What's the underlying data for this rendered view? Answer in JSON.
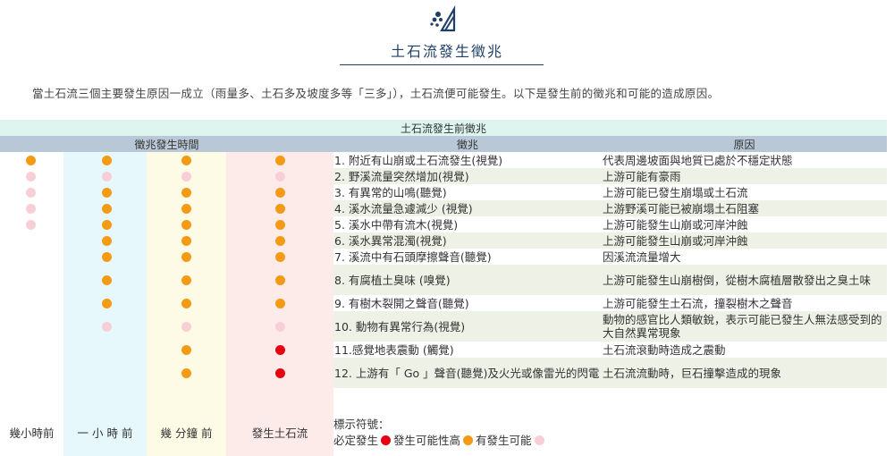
{
  "header": {
    "title": "土石流發生徵兆"
  },
  "intro": "當土石流三個主要發生原因一成立（雨量多、土石多及坡度多等「三多」），土石流便可能發生。以下是發生前的徵兆和可能的造成原因。",
  "table": {
    "caption": "土石流發生前徵兆",
    "col_time": "徵兆發生時間",
    "col_sign": "徵兆",
    "col_cause": "原因",
    "time_labels": [
      "幾小時前",
      "一 小 時 前",
      "幾 分鐘 前",
      "發生土石流"
    ],
    "rows": [
      {
        "sign": "1. 附近有山崩或土石流發生(視覺)",
        "cause": "代表周邊坡面與地質已處於不穩定狀態",
        "dots": [
          "orange",
          "orange",
          "orange",
          "orange"
        ]
      },
      {
        "sign": "2. 野溪流量突然增加(視覺)",
        "cause": "上游可能有豪雨",
        "dots": [
          "pink",
          "pink",
          "pink",
          "pink"
        ]
      },
      {
        "sign": "3. 有異常的山鳴(聽覺)",
        "cause": "上游可能已發生崩塌或土石流",
        "dots": [
          "pink",
          "orange",
          "orange",
          "orange"
        ]
      },
      {
        "sign": "4. 溪水流量急遽減少 (視覺)",
        "cause": "上游野溪可能已被崩塌土石阻塞",
        "dots": [
          "pink",
          "orange",
          "orange",
          "orange"
        ]
      },
      {
        "sign": "5. 溪水中帶有流木(視覺)",
        "cause": "上游可能發生山崩或河岸沖蝕",
        "dots": [
          "pink",
          "orange",
          "orange",
          "orange"
        ]
      },
      {
        "sign": "6. 溪水異常混濁(視覺)",
        "cause": "上游可能發生山崩或河岸沖蝕",
        "dots": [
          "",
          "orange",
          "orange",
          "orange"
        ]
      },
      {
        "sign": "7. 溪流中有石頭摩擦聲音(聽覺)",
        "cause": "因溪流流量增大",
        "dots": [
          "",
          "orange",
          "orange",
          "orange"
        ]
      },
      {
        "sign": "8. 有腐植土臭味 (嗅覺)",
        "cause": "上游可能發生山崩樹倒，從樹木腐植層散發出之臭土味",
        "dots": [
          "",
          "orange",
          "orange",
          "orange"
        ]
      },
      {
        "sign": "9. 有樹木裂開之聲音(聽覺)",
        "cause": "上游可能發生土石流，撞裂樹木之聲音",
        "dots": [
          "",
          "orange",
          "orange",
          "orange"
        ]
      },
      {
        "sign": "10. 動物有異常行為(視覺)",
        "cause": "動物的感官比人類敏銳，表示可能已發生人無法感受到的大自然異常現象",
        "dots": [
          "",
          "pink",
          "pink",
          "pink"
        ]
      },
      {
        "sign": "11.感覺地表震動 (觸覺)",
        "cause": "土石流滾動時造成之震動",
        "dots": [
          "",
          "",
          "orange",
          "red"
        ]
      },
      {
        "sign": "12. 上游有「 Go 」聲音(聽覺)及火光或像雷光的閃電",
        "cause": "土石流流動時，巨石撞擊造成的現象",
        "dots": [
          "",
          "",
          "orange",
          "red"
        ]
      }
    ]
  },
  "legend": {
    "title": "標示符號：",
    "red_label": "必定發生",
    "orange_label": "發生可能性高",
    "pink_label": "有發生可能"
  },
  "colors": {
    "orange": "#f59a15",
    "pink": "#f8cfd6",
    "red": "#e60012",
    "title_blue": "#1f3f66",
    "header_bg": "#b9c8d6",
    "caption_bg": "#ddf5ee"
  }
}
